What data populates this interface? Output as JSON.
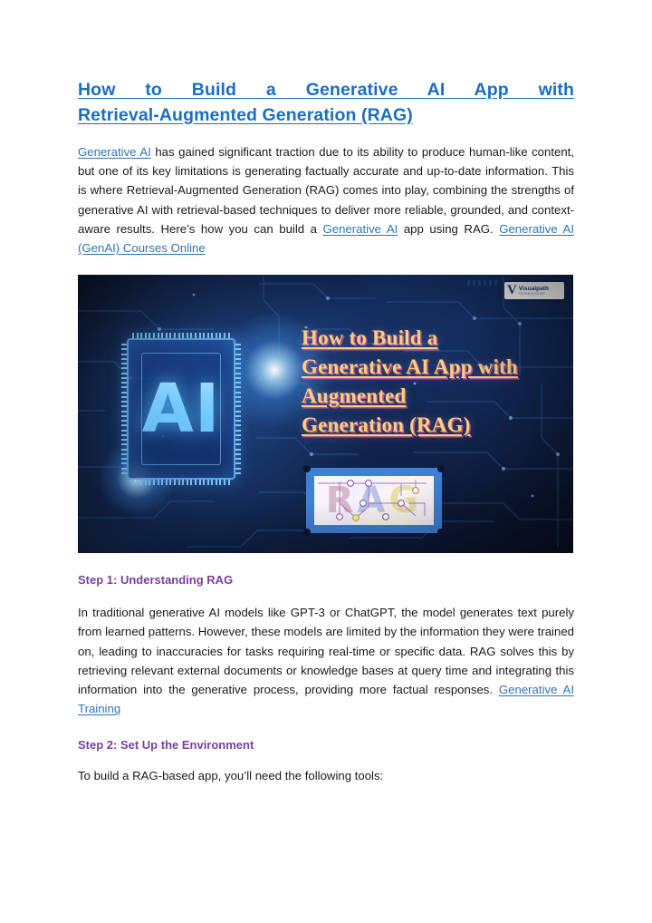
{
  "document": {
    "title_line1": "How to Build a Generative AI App with",
    "title_line2": "Retrieval-Augmented Generation (RAG)",
    "intro": {
      "link_lead": "Generative AI",
      "text_1": " has gained significant traction due to its ability to produce human-like content, but one of its key limitations is generating factually accurate and up-to-date information. This is where Retrieval-Augmented Generation (RAG) comes into play, combining the strengths of generative AI with retrieval-based techniques to deliver more reliable, grounded, and context-aware results. Here’s how you can build a ",
      "link_mid": "Generative AI",
      "text_2": " app using RAG. ",
      "link_end": "Generative AI (GenAI) Courses Online"
    },
    "step1": {
      "heading": "Step 1: Understanding RAG",
      "body_1": "In traditional generative AI models like GPT-3 or ChatGPT, the model generates text purely from learned patterns. However, these models are limited by the information they were trained on, leading to inaccuracies for tasks requiring real-time or specific data. RAG solves this by retrieving relevant external documents or knowledge bases at query time and integrating this information into the generative process, providing more factual responses. ",
      "link_end": "Generative AI Training"
    },
    "step2": {
      "heading": "Step 2: Set Up the Environment",
      "body": "To build a RAG-based app, you’ll need the following tools:"
    }
  },
  "banner": {
    "chip_label": "AI",
    "headline_lines": [
      "How to Build a",
      "Generative AI App with",
      "Augmented",
      "Generation (RAG)"
    ],
    "logo": {
      "mark": "V",
      "name": "Visualpath",
      "tagline": "TECHNOLOGIES"
    },
    "stamp": {
      "letter_1": "R",
      "letter_2": "A",
      "letter_3": "G"
    }
  },
  "colors": {
    "title_blue": "#1B6EC2",
    "link_blue": "#2E74B5",
    "heading_purple": "#7B3F9D",
    "body_text": "#1a1a1a",
    "banner_dark": "#0c1630",
    "banner_gold": "#f7d27a",
    "stamp_border": "#3f7fd4"
  }
}
